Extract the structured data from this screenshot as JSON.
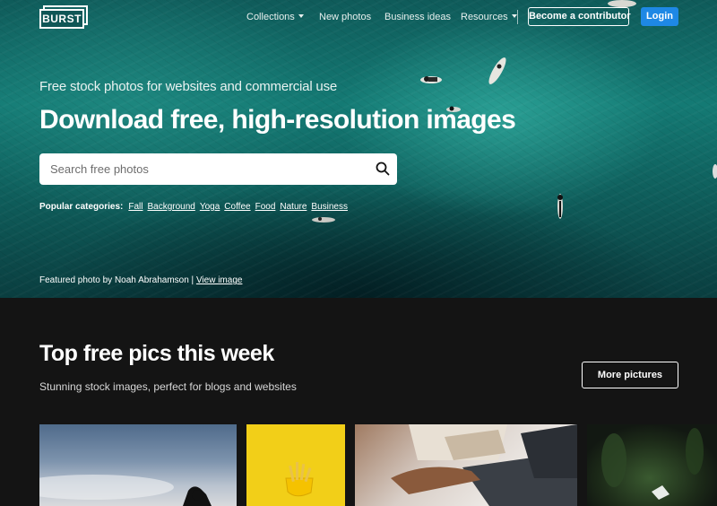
{
  "nav": {
    "logo_text": "BURST",
    "links": [
      "Collections",
      "New photos",
      "Business ideas",
      "Resources"
    ],
    "contributor_button": "Become a contributor",
    "login_button": "Login"
  },
  "hero": {
    "subtitle": "Free stock photos for websites and commercial use",
    "title": "Download free, high-resolution images",
    "search_placeholder": "Search free photos",
    "popular_label": "Popular categories:",
    "categories": [
      "Fall",
      "Background",
      "Yoga",
      "Coffee",
      "Food",
      "Nature",
      "Business"
    ],
    "credit_text": "Featured photo by Noah Abrahamson | ",
    "credit_link": "View image"
  },
  "section": {
    "title": "Top free pics this week",
    "subtitle": "Stunning stock images, perfect for blogs and websites",
    "more_button": "More pictures"
  },
  "colors": {
    "hero_teal": "#147a74",
    "login_blue": "#1e88e5",
    "section_bg": "#141414",
    "thumb_yellow": "#f2cf18"
  }
}
